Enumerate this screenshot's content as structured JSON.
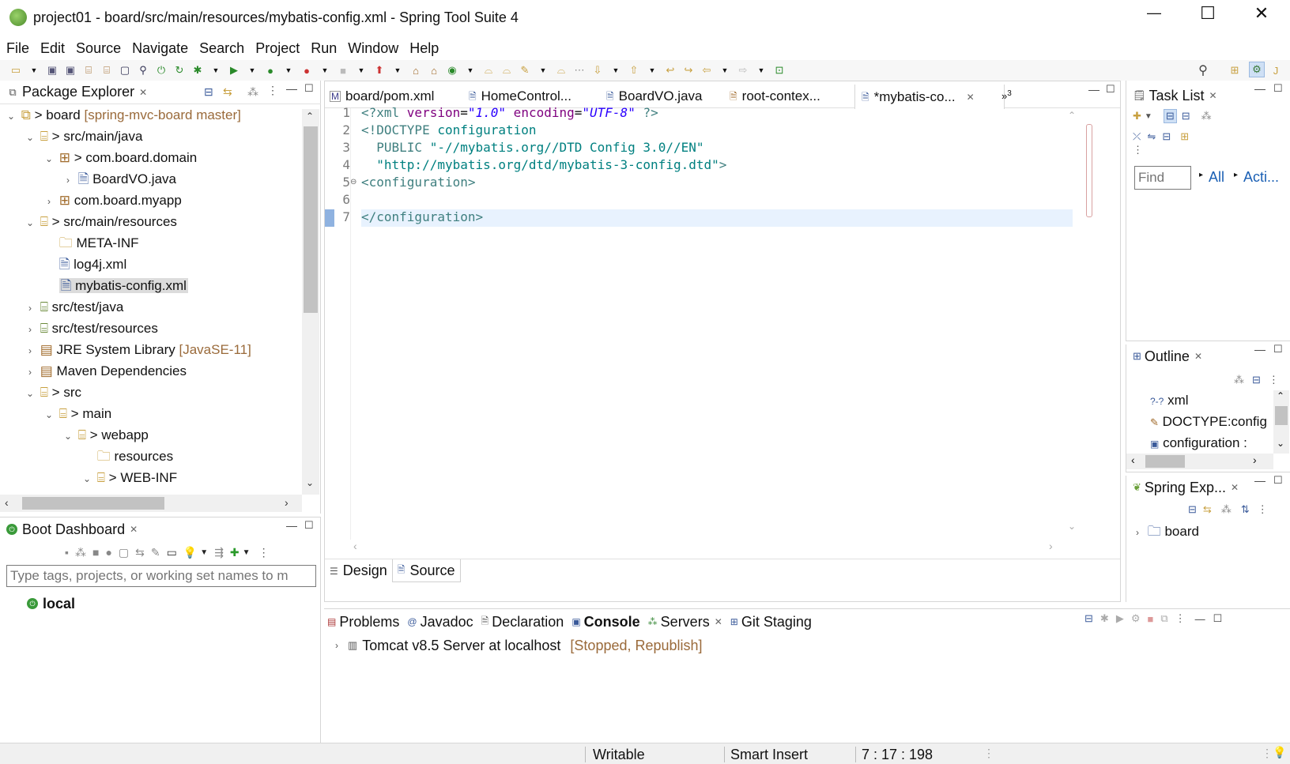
{
  "window": {
    "title": "project01 - board/src/main/resources/mybatis-config.xml - Spring Tool Suite 4",
    "controls": [
      "—",
      "☐",
      "✕"
    ]
  },
  "menu": [
    "File",
    "Edit",
    "Source",
    "Navigate",
    "Search",
    "Project",
    "Run",
    "Window",
    "Help"
  ],
  "package_explorer": {
    "title": "Package Explorer",
    "items": [
      {
        "label": "board",
        "deco": "[spring-mvc-board master]",
        "prefix": "> ",
        "twisty": "open"
      },
      {
        "label": "src/main/java",
        "prefix": "> ",
        "twisty": "open"
      },
      {
        "label": "com.board.domain",
        "prefix": "> ",
        "twisty": "open"
      },
      {
        "label": "BoardVO.java",
        "prefix": "",
        "twisty": "closed"
      },
      {
        "label": "com.board.myapp",
        "prefix": "",
        "twisty": "closed"
      },
      {
        "label": "src/main/resources",
        "prefix": "> ",
        "twisty": "open"
      },
      {
        "label": "META-INF",
        "prefix": "",
        "twisty": ""
      },
      {
        "label": "log4j.xml",
        "prefix": "",
        "twisty": ""
      },
      {
        "label": "mybatis-config.xml",
        "prefix": "",
        "twisty": ""
      },
      {
        "label": "src/test/java",
        "prefix": "",
        "twisty": "closed"
      },
      {
        "label": "src/test/resources",
        "prefix": "",
        "twisty": "closed"
      },
      {
        "label": "JRE System Library",
        "deco": "[JavaSE-11]",
        "prefix": "",
        "twisty": "closed"
      },
      {
        "label": "Maven Dependencies",
        "prefix": "",
        "twisty": "closed"
      },
      {
        "label": "src",
        "prefix": "> ",
        "twisty": "open"
      },
      {
        "label": "main",
        "prefix": "> ",
        "twisty": "open"
      },
      {
        "label": "webapp",
        "prefix": "> ",
        "twisty": "open"
      },
      {
        "label": "resources",
        "prefix": "",
        "twisty": ""
      },
      {
        "label": "WEB-INF",
        "prefix": "> ",
        "twisty": "open"
      }
    ]
  },
  "boot_dashboard": {
    "title": "Boot Dashboard",
    "filter_placeholder": "Type tags, projects, or working set names to m",
    "items": [
      "local"
    ]
  },
  "editor": {
    "tabs": [
      "board/pom.xml",
      "HomeControl...",
      "BoardVO.java",
      "root-contex...",
      "*mybatis-co..."
    ],
    "overflow_count": "3",
    "bottom_tabs": [
      "Design",
      "Source"
    ],
    "lines": [
      {
        "n": "1"
      },
      {
        "n": "2"
      },
      {
        "n": "3"
      },
      {
        "n": "4"
      },
      {
        "n": "5"
      },
      {
        "n": "6"
      },
      {
        "n": "7"
      }
    ],
    "code": {
      "l1_a": "<?xml ",
      "l1_b": "version",
      "l1_c": "=",
      "l1_d": "\"1.0\"",
      "l1_e": " encoding",
      "l1_f": "=",
      "l1_g": "\"UTF-8\"",
      "l1_h": " ?>",
      "l2_a": "<!DOCTYPE ",
      "l2_b": "configuration",
      "l3_a": "  PUBLIC ",
      "l3_b": "\"-//mybatis.org//DTD Config 3.0//EN\"",
      "l4_a": "  ",
      "l4_b": "\"http://mybatis.org/dtd/mybatis-3-config.dtd\"",
      "l4_c": ">",
      "l5": "<configuration>",
      "l7": "</configuration>"
    }
  },
  "bottom_panel": {
    "tabs": [
      "Problems",
      "Javadoc",
      "Declaration",
      "Console",
      "Servers",
      "Git Staging"
    ],
    "active_tab": "Console",
    "server_label": "Tomcat v8.5 Server at localhost",
    "server_status": "[Stopped, Republish]"
  },
  "task_list": {
    "title": "Task List",
    "find_placeholder": "Find",
    "all_label": "All",
    "acti_label": "Acti..."
  },
  "outline": {
    "title": "Outline",
    "items": [
      "xml",
      "DOCTYPE:config",
      "configuration :"
    ]
  },
  "spring_explorer": {
    "title": "Spring Exp...",
    "items": [
      "board"
    ]
  },
  "status_bar": {
    "writable": "Writable",
    "insert_mode": "Smart Insert",
    "position": "7 : 17 : 198"
  },
  "colors": {
    "tag": "#3f7f7f",
    "attribute": "#7f007f",
    "string": "#2a00ff",
    "decoration": "#9a6a3a",
    "selection": "#e8f2fe"
  }
}
